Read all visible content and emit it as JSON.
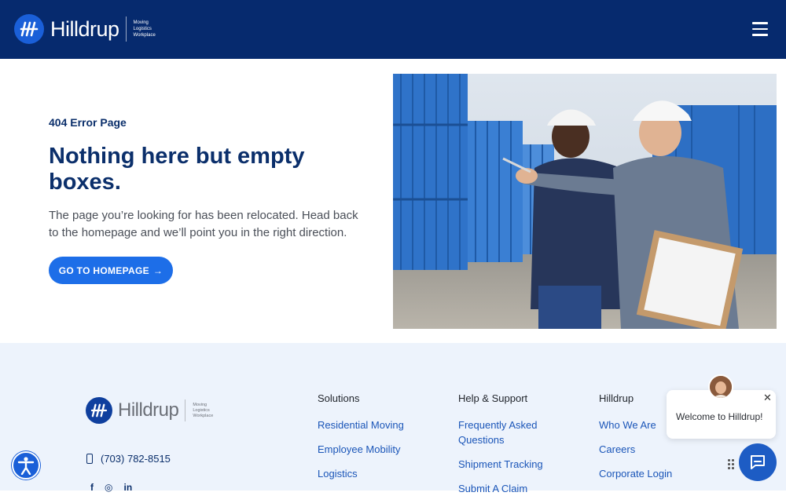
{
  "header": {
    "brand": "Hilldrup",
    "tagline": [
      "Moving",
      "Logistics",
      "Workplace"
    ],
    "menu_icon": "hamburger-icon",
    "bg_color": "#062a6e"
  },
  "main": {
    "eyebrow": "404 Error Page",
    "headline": "Nothing here but empty boxes.",
    "body": "The page you’re looking for has been relocated. Head back to the homepage and we’ll point you in the right direction.",
    "cta_label": "GO TO HOMEPAGE",
    "cta_icon": "arrow-right-icon",
    "accent_color": "#1d6ee8"
  },
  "footer": {
    "brand": "Hilldrup",
    "tagline": [
      "Moving",
      "Logistics",
      "Workplace"
    ],
    "phone": "(703) 782-8515",
    "social_icons": [
      "facebook-icon",
      "instagram-icon",
      "linkedin-icon"
    ],
    "columns": [
      {
        "title": "Solutions",
        "links": [
          "Residential Moving",
          "Employee Mobility",
          "Logistics"
        ]
      },
      {
        "title": "Help & Support",
        "links": [
          "Frequently Asked Questions",
          "Shipment Tracking",
          "Submit A Claim"
        ]
      },
      {
        "title": "Hilldrup",
        "links": [
          "Who We Are",
          "Careers",
          "Corporate Login"
        ]
      }
    ]
  },
  "chat": {
    "welcome": "Welcome to Hilldrup!",
    "close_icon": "close-icon",
    "launcher_icon": "chat-icon"
  },
  "accessibility": {
    "icon": "accessibility-icon"
  }
}
